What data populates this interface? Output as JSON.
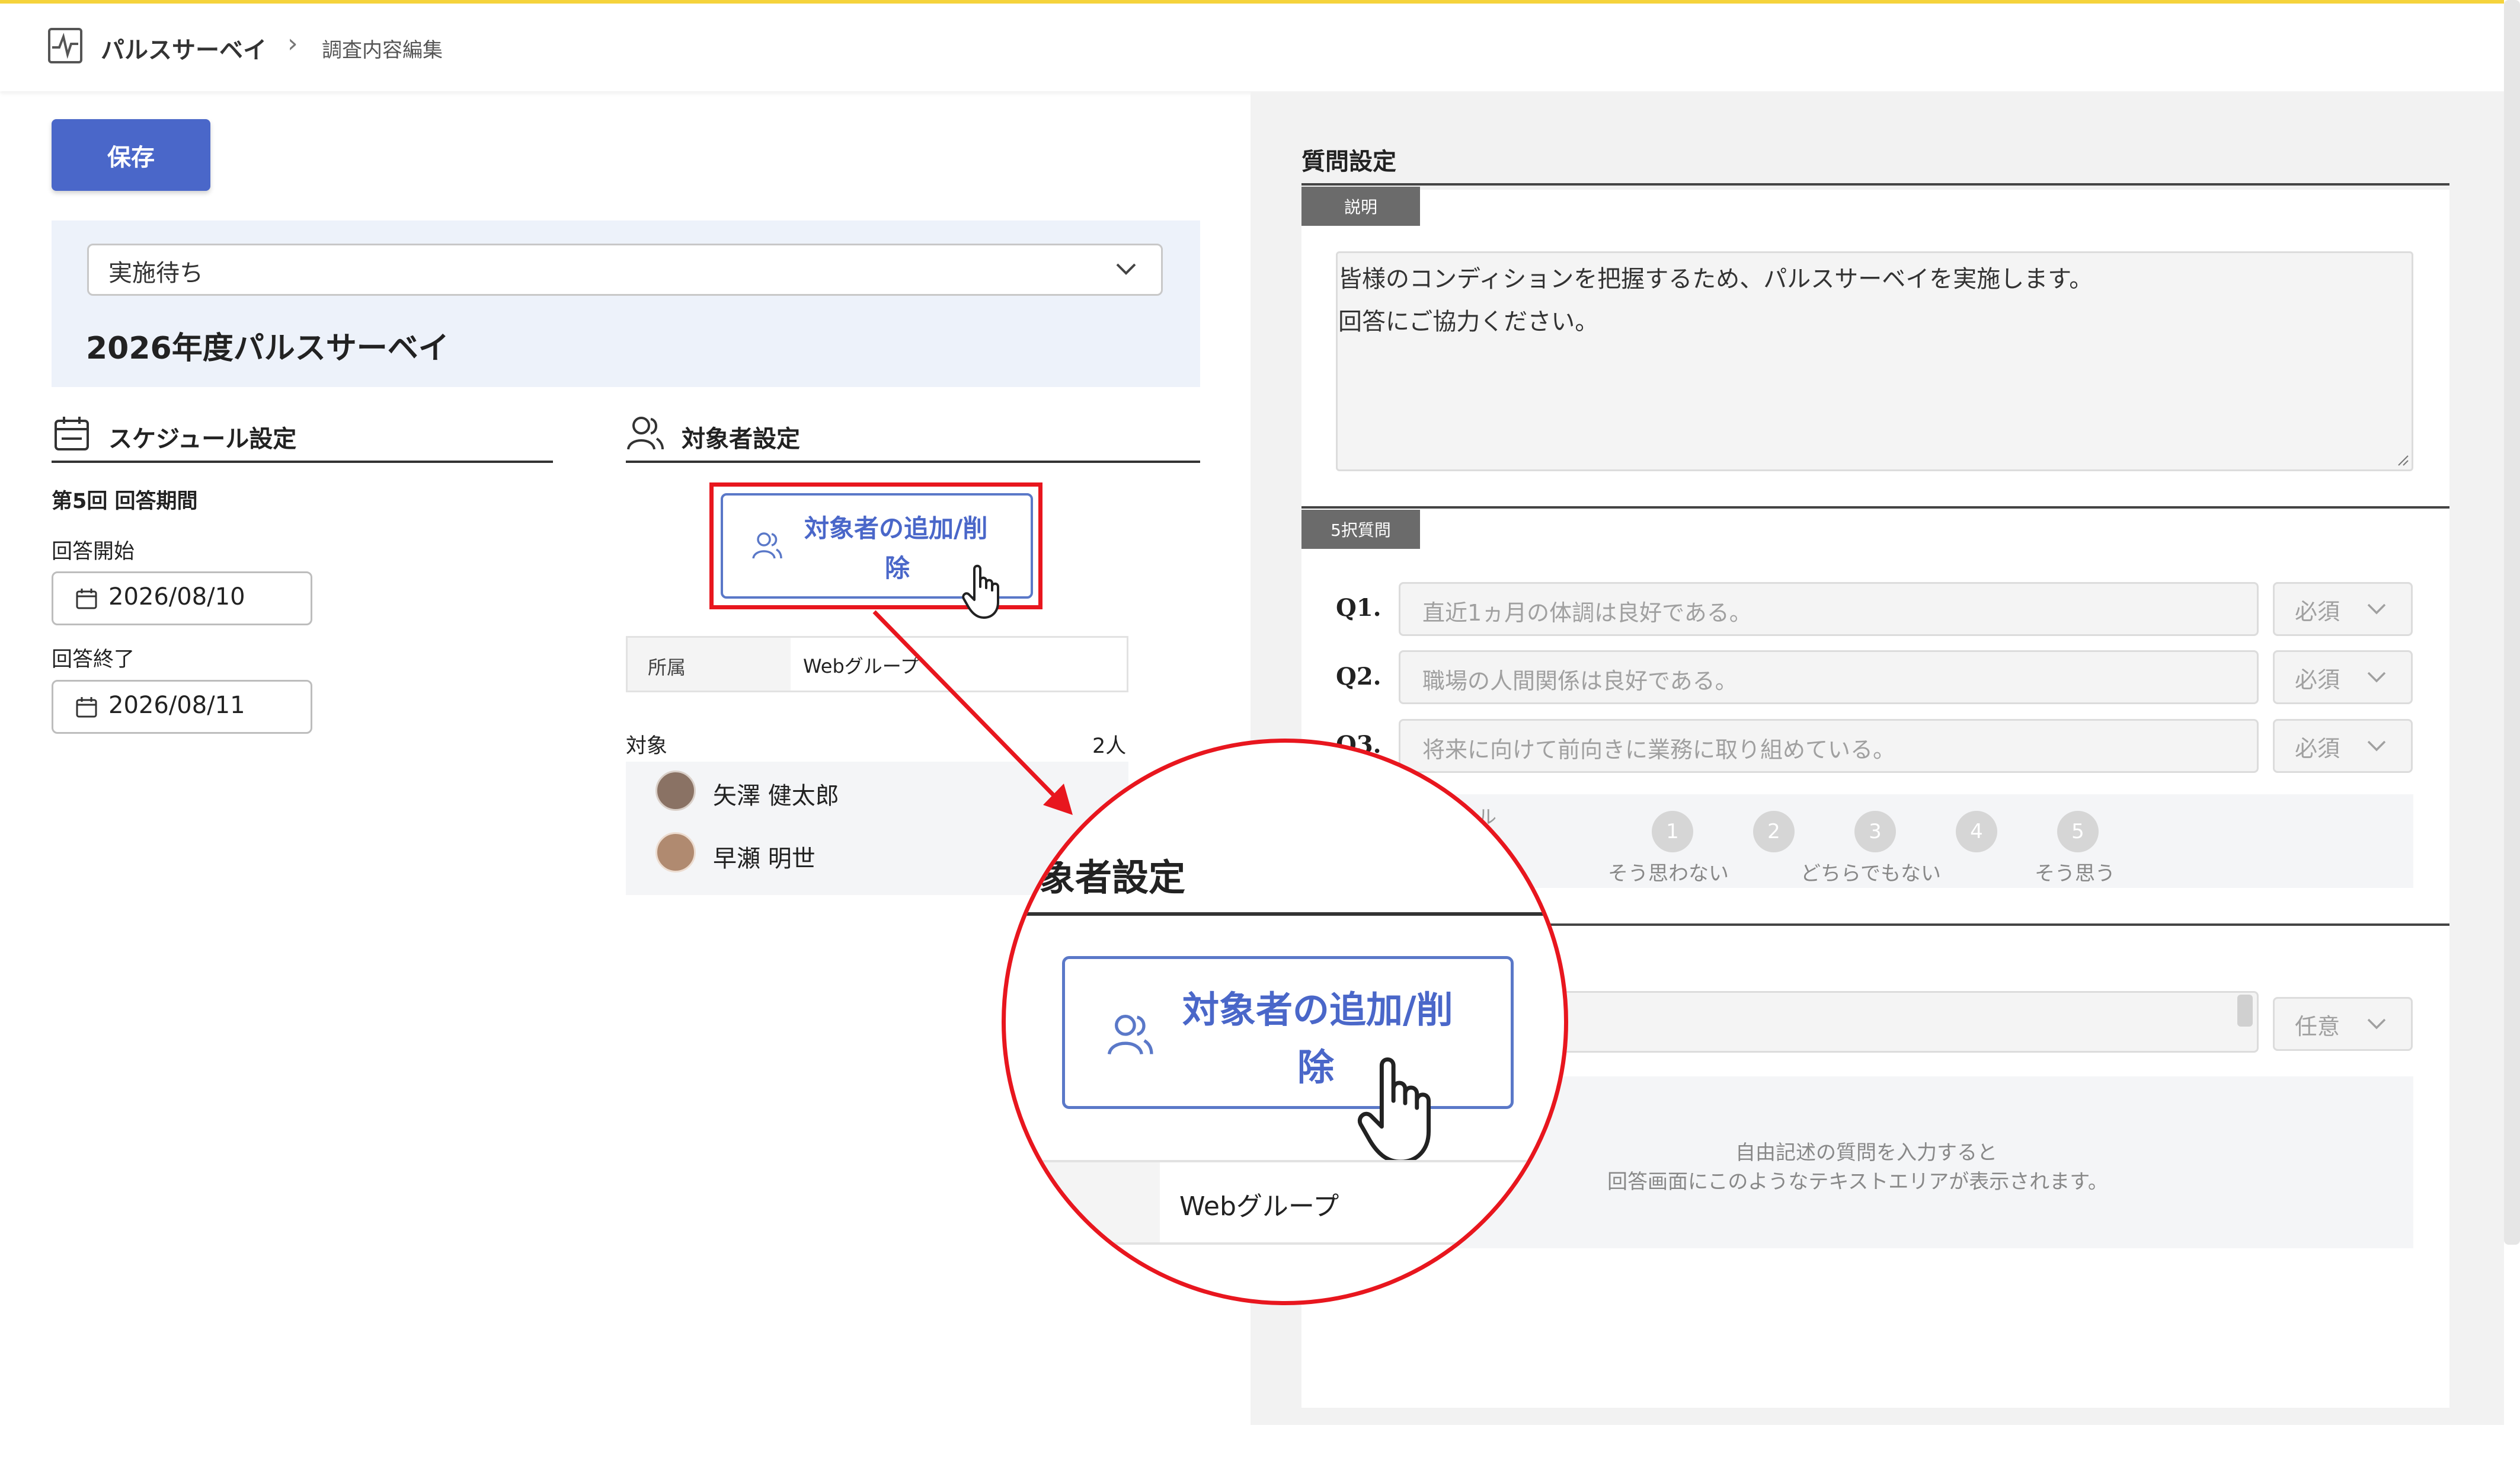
{
  "header": {
    "app_title": "パルスサーベイ",
    "separator": "›",
    "breadcrumb_current": "調査内容編集"
  },
  "toolbar": {
    "save_label": "保存"
  },
  "survey": {
    "status_value": "実施待ち",
    "title": "2026年度パルスサーベイ"
  },
  "schedule": {
    "heading": "スケジュール設定",
    "period_label": "第5回 回答期間",
    "start_label": "回答開始",
    "start_value": "2026/08/10",
    "end_label": "回答終了",
    "end_value": "2026/08/11"
  },
  "target": {
    "heading": "対象者設定",
    "add_remove_line1": "対象者の追加/削",
    "add_remove_line2": "除",
    "belong_label": "所属",
    "belong_value": "Webグループ",
    "target_label": "対象",
    "target_count": "2人",
    "members": [
      "矢澤 健太郎",
      "早瀬 明世"
    ]
  },
  "questions": {
    "heading": "質問設定",
    "description_tab": "説明",
    "description_text_line1": "皆様のコンディションを把握するため、パルスサーベイを実施します。",
    "description_text_line2": "回答にご協力ください。",
    "five_choice_tab": "5択質問",
    "items": [
      {
        "label": "Q1.",
        "placeholder": "直近1ヵ月の体調は良好である。",
        "required": "必須"
      },
      {
        "label": "Q2.",
        "placeholder": "職場の人間関係は良好である。",
        "required": "必須"
      },
      {
        "label": "Q3.",
        "placeholder": "将来に向けて前向きに業務に取り組めている。",
        "required": "必須"
      }
    ],
    "scale_fragment": "ル",
    "scale_numbers": [
      "1",
      "2",
      "3",
      "4",
      "5"
    ],
    "scale_labels": [
      "そう思わない",
      "どちらでもない",
      "そう思う"
    ],
    "free_required": "任意",
    "free_hint_line1": "自由記述の質問を入力すると",
    "free_hint_line2": "回答画面にこのようなテキストエリアが表示されます。"
  },
  "zoom": {
    "heading_fragment": "象者設定",
    "button_line1": "対象者の追加/削",
    "button_line2": "除",
    "belong_value": "Webグループ"
  },
  "colors": {
    "accent": "#4a67c9",
    "highlight_red": "#e8161e",
    "top_border": "#f5d33c"
  }
}
